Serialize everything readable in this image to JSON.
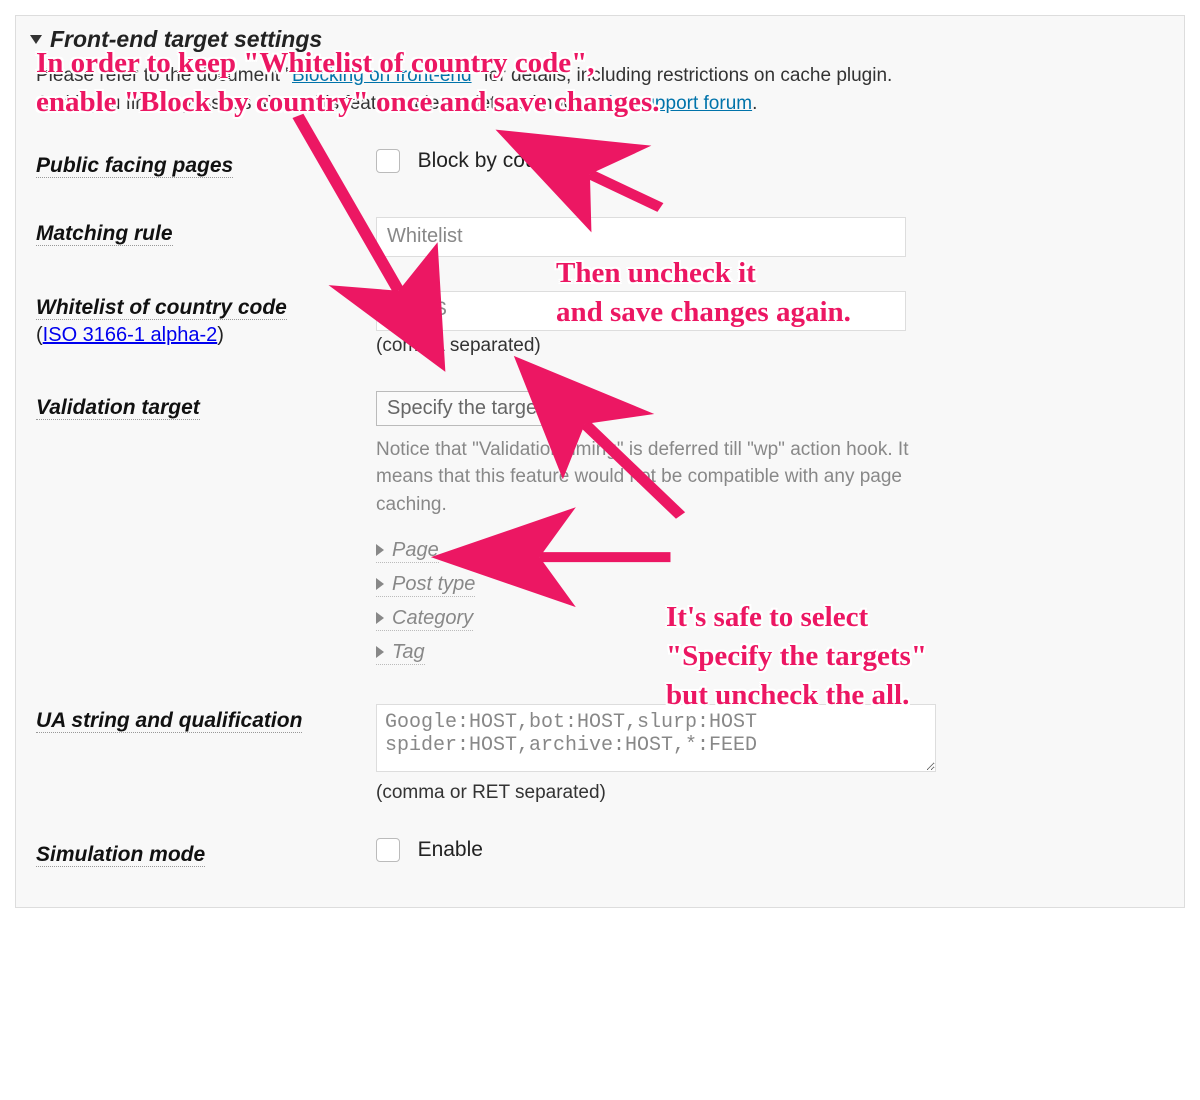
{
  "section": {
    "title": "Front-end target settings",
    "desc_before": "Please refer to the document \"",
    "desc_link": "Blocking on front-end",
    "desc_after": "\" for details, including restrictions on cache plugin.",
    "desc2_before": "And if you find any issues about this feature, please let me know ",
    "desc2_link": "at the support forum",
    "desc2_after": "."
  },
  "rows": {
    "public_facing": {
      "label": "Public facing pages",
      "checkbox_label": "Block by country"
    },
    "matching_rule": {
      "label": "Matching rule",
      "value": "Whitelist"
    },
    "whitelist": {
      "label": "Whitelist of country code",
      "link_text": "ISO 3166-1 alpha-2",
      "value": "JP,US",
      "hint": "(comma separated)"
    },
    "validation_target": {
      "label": "Validation target",
      "select_value": "Specify the targets",
      "notice": "Notice that \"Validation timing\" is deferred till \"wp\" action hook. It means that this feature would not be compatible with any page caching.",
      "items": [
        "Page",
        "Post type",
        "Category",
        "Tag"
      ]
    },
    "ua": {
      "label": "UA string and qualification",
      "value": "Google:HOST,bot:HOST,slurp:HOST\nspider:HOST,archive:HOST,*:FEED",
      "hint": "(comma or RET separated)"
    },
    "simulation": {
      "label": "Simulation mode",
      "checkbox_label": "Enable"
    }
  },
  "annotations": {
    "a1": "In order to keep \"Whitelist of country code\",\nenable \"Block by country\" once and save changes.",
    "a2": "Then uncheck it\nand save changes again.",
    "a3": "It's safe to select\n\"Specify the targets\"\nbut uncheck the all."
  },
  "colors": {
    "accent": "#ec1763",
    "link": "#0073aa"
  }
}
